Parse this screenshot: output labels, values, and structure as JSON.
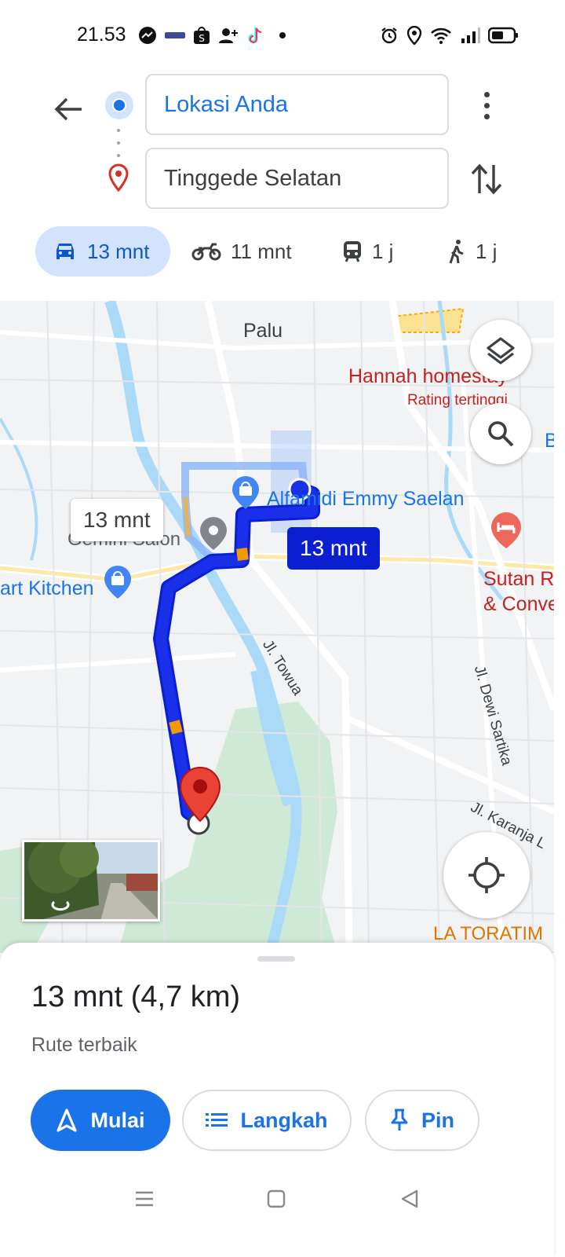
{
  "status_bar": {
    "time": "21.53"
  },
  "search": {
    "origin": "Lokasi Anda",
    "destination": "Tinggede Selatan"
  },
  "modes": [
    {
      "label": "13 mnt",
      "icon": "car-icon",
      "active": true
    },
    {
      "label": "11 mnt",
      "icon": "motorcycle-icon"
    },
    {
      "label": "1 j",
      "icon": "transit-icon"
    },
    {
      "label": "1 j",
      "icon": "walk-icon"
    }
  ],
  "map": {
    "labels": {
      "city": "Palu",
      "hotel_name": "Hannah homestay",
      "hotel_rating": "Rating tertinggi",
      "hotel_right_1": "Sutan R",
      "hotel_right_2": "& Conve",
      "shop": "Alfamidi Emmy Saelan",
      "salon": "Gemini Salon",
      "kitchen": "art Kitchen",
      "street_towua": "Jl. Towua",
      "street_dewi": "Jl. Dewi Sartika",
      "street_karanja": "Jl. Karanja L",
      "toratima": "LA TORATIM",
      "edge_b": "B"
    },
    "eta_alternative": "13 mnt",
    "eta_main": "13 mnt"
  },
  "route": {
    "summary": "13 mnt (4,7 km)",
    "subtitle": "Rute terbaik"
  },
  "actions": {
    "start": "Mulai",
    "steps": "Langkah",
    "pin": "Pin"
  },
  "colors": {
    "route_blue": "#1a2fe8",
    "accent_blue": "#1a73e8",
    "destination_red": "#ea4335"
  }
}
